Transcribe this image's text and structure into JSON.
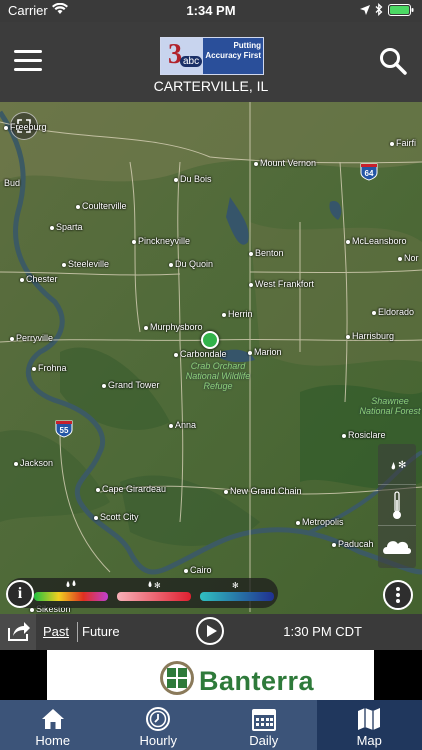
{
  "status_bar": {
    "carrier": "Carrier",
    "time": "1:34 PM"
  },
  "header": {
    "logo": {
      "channel": "3",
      "network": "abc",
      "tagline": "Putting Accuracy First"
    },
    "location": "CARTERVILLE, IL"
  },
  "map": {
    "cities": [
      "Freeburg",
      "Mount Vernon",
      "Fairfi",
      "Du Bois",
      "Bud",
      "Coulterville",
      "Sparta",
      "Pinckneyville",
      "McLeansboro",
      "Steeleville",
      "Du Quoin",
      "Benton",
      "Nor",
      "Chester",
      "West Frankfort",
      "Eldorado",
      "Herrin",
      "Perryville",
      "Murphysboro",
      "Harrisburg",
      "Carbondale",
      "Marion",
      "Frohna",
      "Grand Tower",
      "Anna",
      "Rosiclare",
      "Jackson",
      "Cape Girardeau",
      "New Grand Chain",
      "Scott City",
      "Metropolis",
      "Paducah",
      "Cairo",
      "Sikeston",
      "Be"
    ],
    "protected_areas": [
      "Crab Orchard National Wildlife Refuge",
      "Shawnee National Forest"
    ],
    "highways": [
      "64",
      "55"
    ],
    "legend": {
      "colors": [
        "#20c040",
        "#f0d020",
        "#e03020",
        "#c040d0",
        "#f8b0b8",
        "#e02030",
        "#30c0c0",
        "#203090"
      ]
    }
  },
  "timeline": {
    "past_label": "Past",
    "future_label": "Future",
    "time": "1:30 PM CDT"
  },
  "ad": {
    "brand": "Banterra"
  },
  "tabs": [
    {
      "label": "Home",
      "icon": "home-icon"
    },
    {
      "label": "Hourly",
      "icon": "clock-icon"
    },
    {
      "label": "Daily",
      "icon": "calendar-icon"
    },
    {
      "label": "Map",
      "icon": "map-icon"
    }
  ]
}
